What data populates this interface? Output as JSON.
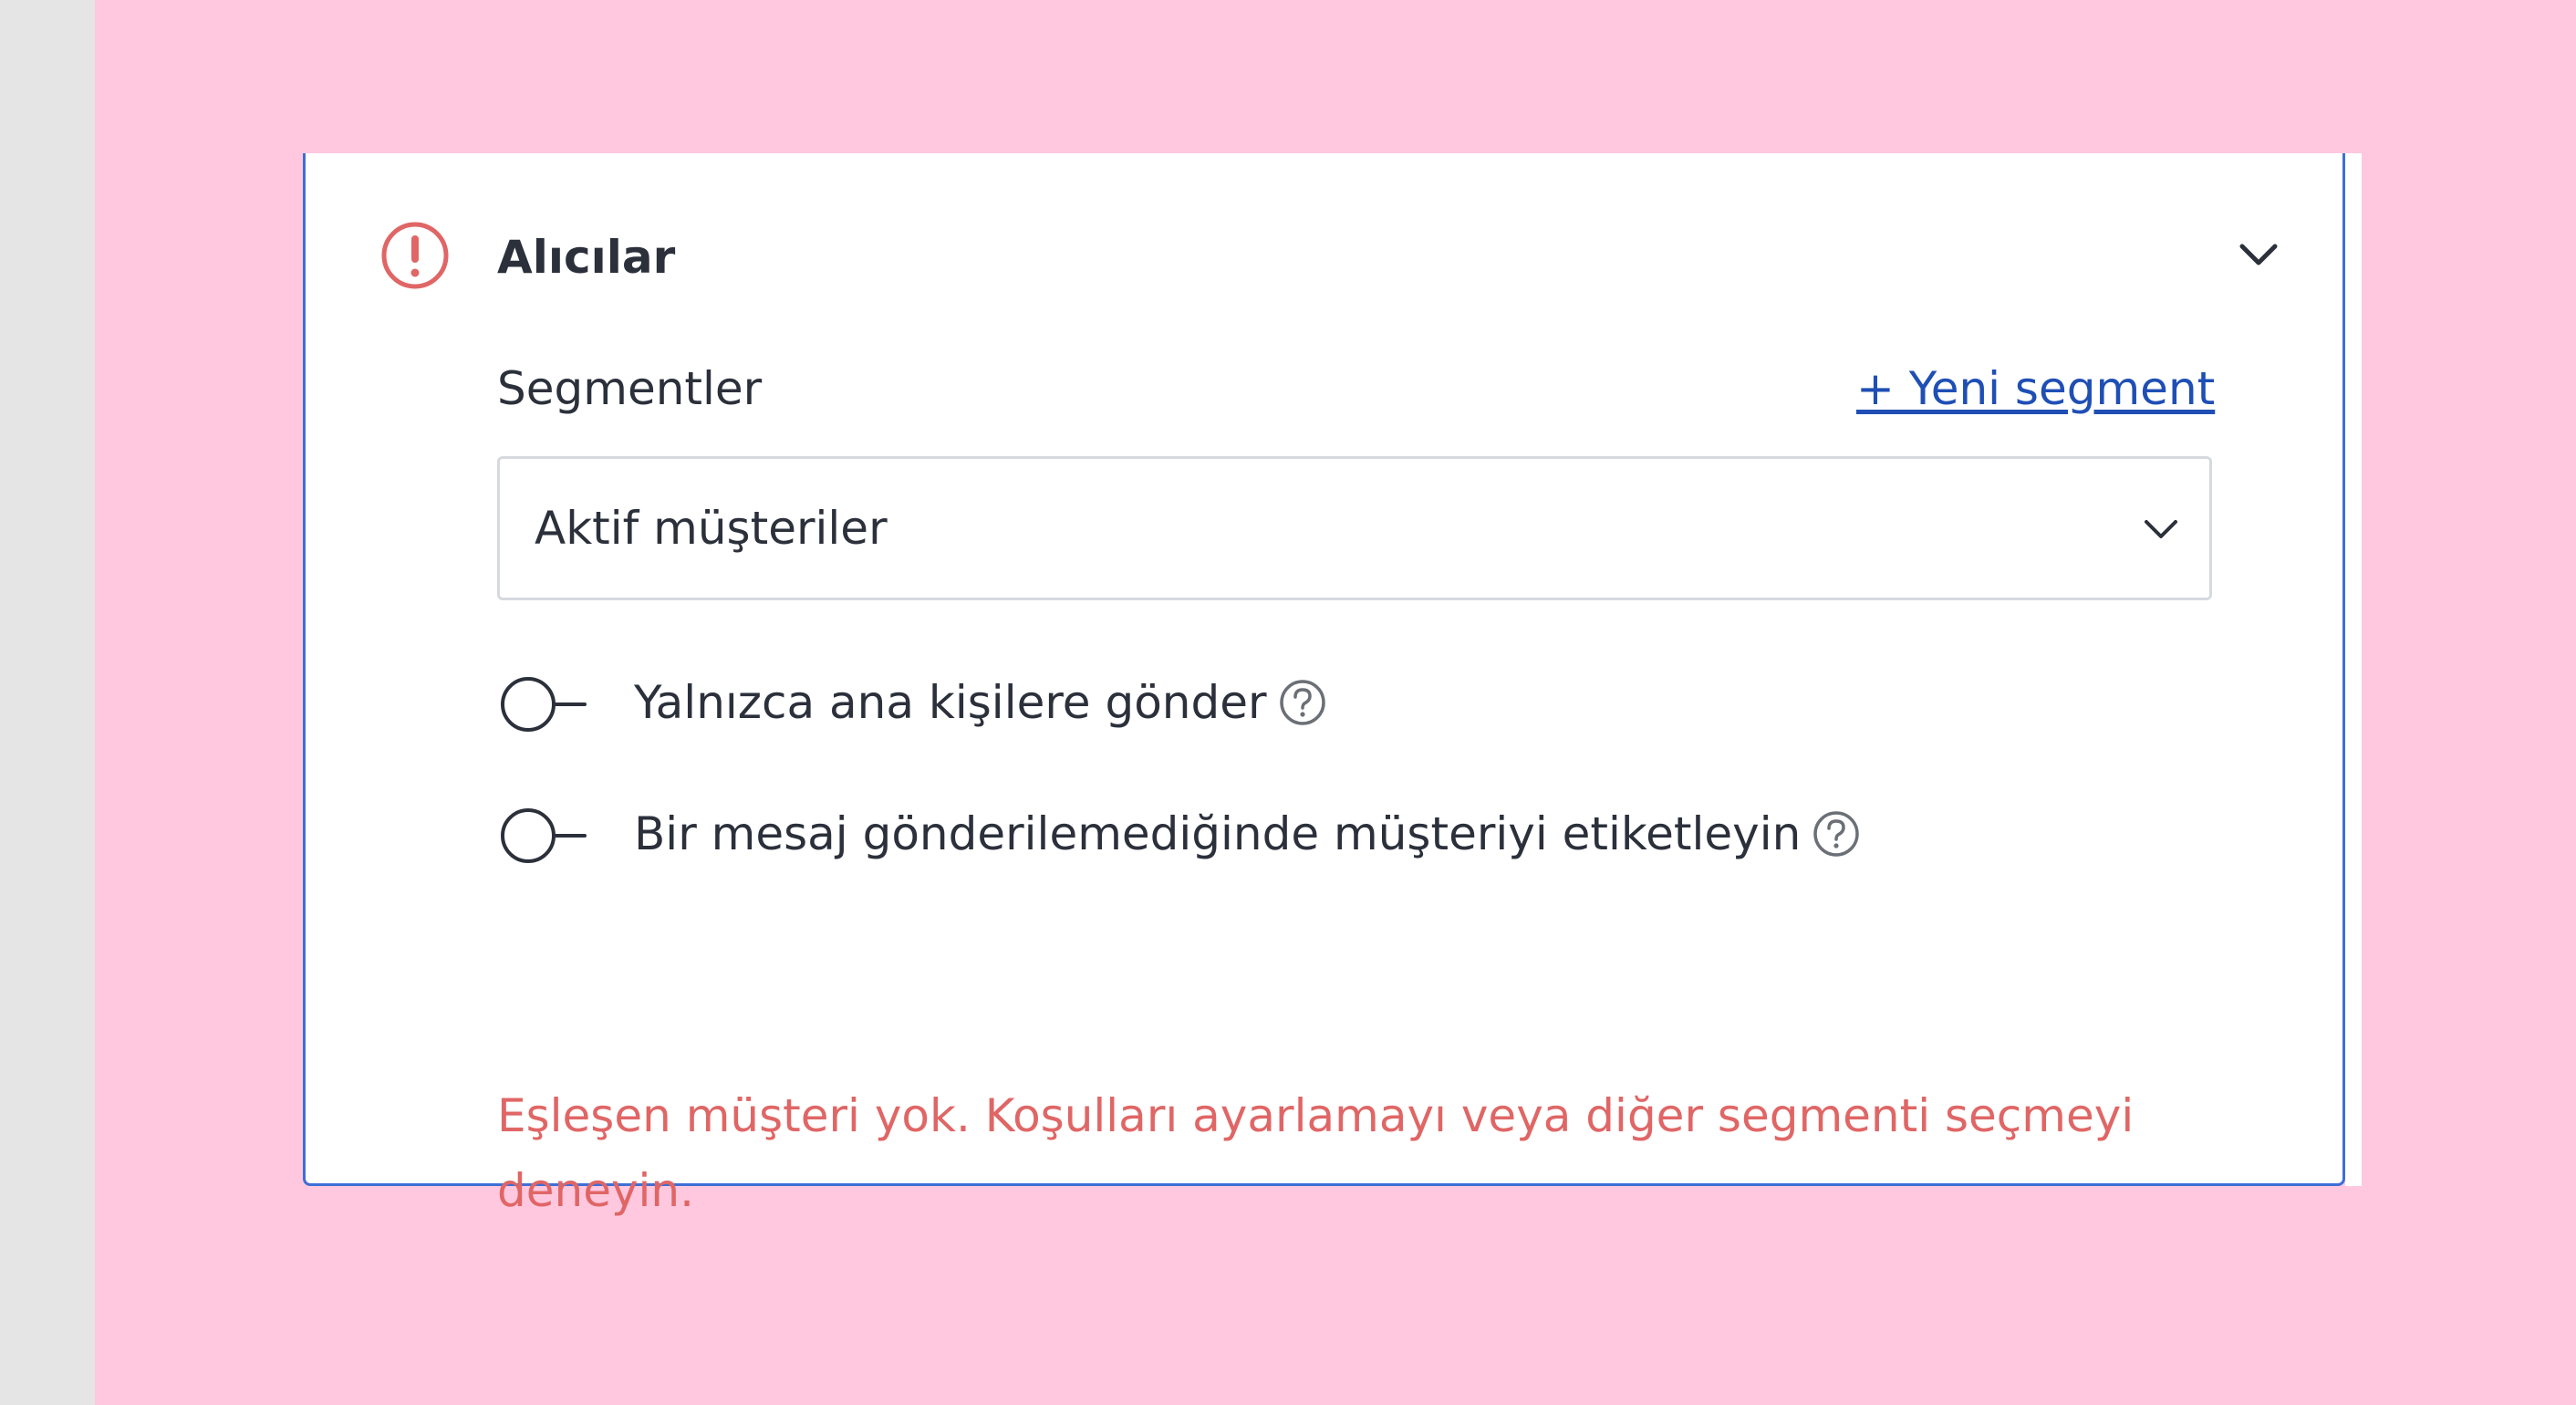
{
  "section": {
    "title": "Alıcılar",
    "status_icon": "exclamation-circle-icon",
    "status_color": "#e06666",
    "collapse_icon": "chevron-down-icon"
  },
  "segments": {
    "label": "Segmentler",
    "new_segment_link": "+ Yeni segment",
    "selected_value": "Aktif müşteriler",
    "dropdown_icon": "chevron-down-icon"
  },
  "toggles": [
    {
      "label": "Yalnızca ana kişilere gönder",
      "checked": false,
      "help_icon": "question-circle-icon"
    },
    {
      "label": "Bir mesaj gönderilemediğinde müşteriyi etiketleyin",
      "checked": false,
      "help_icon": "question-circle-icon"
    }
  ],
  "error_message": "Eşleşen müşteri yok. Koşulları ayarlamayı veya diğer segmenti seçmeyi deneyin.",
  "colors": {
    "accent_border": "#3d6fd6",
    "link": "#1f4fb5",
    "error": "#e06666",
    "backdrop": "#ffc8df"
  }
}
